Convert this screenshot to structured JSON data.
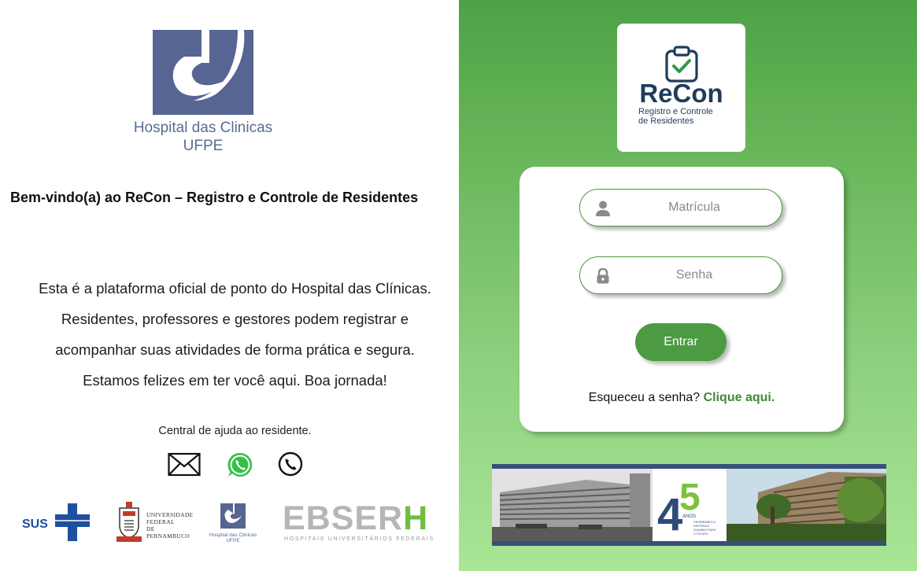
{
  "left": {
    "hospital_logo": {
      "name_line1": "Hospital das Clinicas",
      "name_line2": "UFPE"
    },
    "welcome_title": "Bem-vindo(a) ao ReCon – Registro e Controle de Residentes",
    "intro_lines": [
      "Esta é a plataforma oficial de ponto do Hospital das Clínicas.",
      "Residentes, professores e gestores podem registrar e",
      "acompanhar suas atividades de forma prática e segura.",
      "Estamos felizes em ter você aqui. Boa jornada!"
    ],
    "help_text": "Central de ajuda ao residente.",
    "contact_icons": [
      "email-icon",
      "whatsapp-icon",
      "phone-icon"
    ],
    "partners": {
      "sus": "SUS",
      "ufpe": [
        "UNIVERSIDADE",
        "FEDERAL",
        "DE PERNAMBUCO"
      ],
      "hc_small": [
        "Hospital das Clinicas",
        "UFPE"
      ],
      "ebserh_main": "EBSER",
      "ebserh_h": "H",
      "ebserh_sub": "HOSPITAIS UNIVERSITÁRIOS FEDERAIS"
    }
  },
  "right": {
    "brand": {
      "name": "ReCon",
      "subtitle_line1": "Registro e Controle",
      "subtitle_line2": "de Residentes"
    },
    "login": {
      "user_placeholder": "Matrícula",
      "user_value": "",
      "password_placeholder": "Senha",
      "password_value": "",
      "submit_label": "Entrar",
      "forgot_text": "Esqueceu a senha?",
      "forgot_link": "Clique aqui."
    },
    "banner": {
      "anniversary_number_tens": "4",
      "anniversary_number_ones": "5",
      "anos_label": "ANOS",
      "tagline": [
        "CELEBRANDO A",
        "HISTÓRIA E",
        "OLHANDO PARA",
        "O FUTURO"
      ]
    }
  },
  "colors": {
    "brand_green": "#4c9a41",
    "link_green": "#3f8a33",
    "navy": "#1f3c5c",
    "hc_blue": "#5a6b94"
  }
}
